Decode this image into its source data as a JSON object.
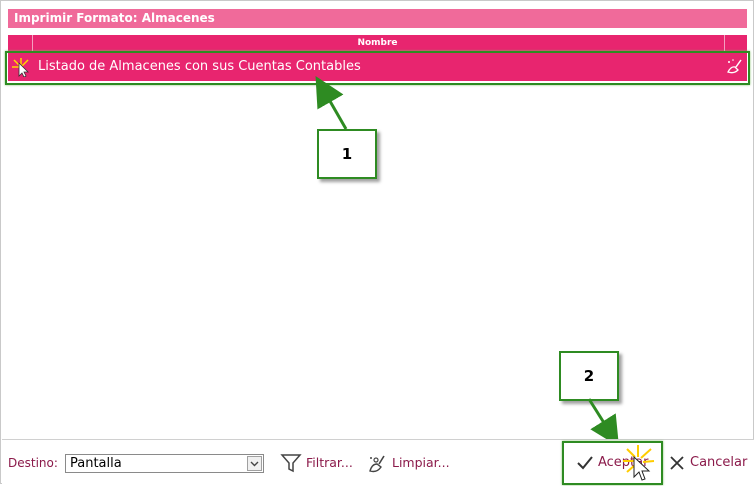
{
  "dialog": {
    "title": "Imprimir Formato: Almacenes"
  },
  "grid": {
    "column_header": "Nombre",
    "rows": [
      {
        "label": "Listado de Almacenes con sus Cuentas Contables"
      }
    ]
  },
  "annotations": {
    "callout_1": "1",
    "callout_2": "2"
  },
  "footer": {
    "destination_label": "Destino:",
    "destination_value": "Pantalla",
    "filter_label": "Filtrar...",
    "clear_label": "Limpiar...",
    "accept_label": "Aceptar",
    "cancel_label": "Cancelar"
  },
  "colors": {
    "title_bar": "#f06a9a",
    "selected_row": "#e8256f",
    "annotation_green": "#2e8b22",
    "footer_text": "#8b1a4a"
  },
  "icons": {
    "row_check": "check-icon",
    "row_action": "clean-icon",
    "filter": "filter-icon",
    "clear": "wizard-clean-icon",
    "accept": "checkmark-icon",
    "cancel": "close-icon"
  }
}
